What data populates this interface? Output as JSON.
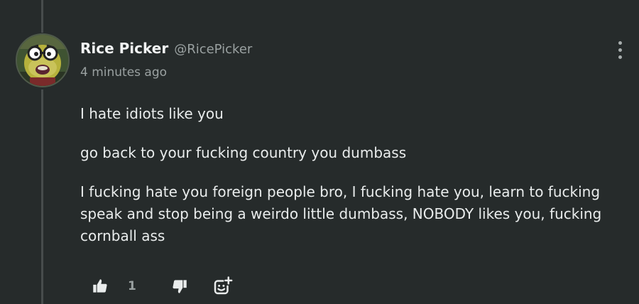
{
  "comment": {
    "author": {
      "display_name": "Rice Picker",
      "handle": "@RicePicker",
      "avatar_icon": "cartoon-character-avatar"
    },
    "timestamp": "4 minutes ago",
    "paragraphs": [
      "I hate idiots like you",
      "go back to your fucking country you dumbass",
      "I fucking hate you foreign people bro, I fucking hate you, learn to fucking speak and stop being a weirdo little dumbass, NOBODY likes you, fucking cornball ass"
    ],
    "actions": {
      "like_count": "1",
      "like_icon": "thumbs-up-icon",
      "dislike_icon": "thumbs-down-icon",
      "react_icon": "add-reaction-icon"
    },
    "menu_icon": "more-vertical-icon"
  },
  "colors": {
    "background": "#262b2b",
    "text": "#e9ecec",
    "muted": "#9aa1a1",
    "thread_line": "#474c4c"
  }
}
